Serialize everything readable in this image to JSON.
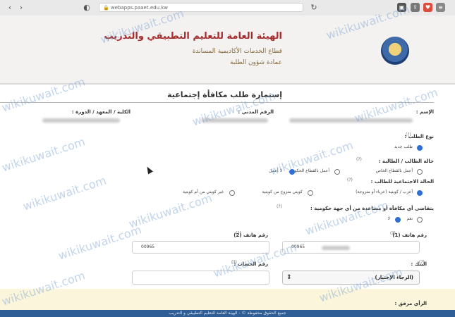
{
  "browser": {
    "url": "webapps.paaet.edu.kw"
  },
  "header": {
    "title": "الهيئة العامة للتعليم التطبيقي والتدريب",
    "subtitle1": "قطاع الخدمات الأكاديمية المساندة",
    "subtitle2": "عمادة شؤون الطلبة"
  },
  "form": {
    "title": "إستمارة طلب مكافأة إجتماعية",
    "name_label": "الإسم :",
    "civil_id_label": "الرقم المدني :",
    "college_label": "الكلية / المعهد / الدورة :",
    "request_type_label": "نوع الطلب :",
    "request_type_options": [
      "طلب جديد"
    ],
    "student_status_label": "حالة الطالب / الطالبة :",
    "student_status_options": [
      "لا أعمل",
      "أعمل بالقطاع الخاص",
      "أعمل بالقطاع الحكومي"
    ],
    "social_status_label": "الحالة الاجتماعية للطالب :",
    "social_status_options": [
      "أعزب / كويتية (عزباء أو متزوجة)",
      "كويتي متزوج من كويتية",
      "غير كويتي من أم كويتية"
    ],
    "gov_aid_label": "يتقاضى أي مكافأة أو مساعدة من أي جهة حكومية :",
    "gov_aid_options": [
      "لا",
      "نعم"
    ],
    "phone1_label": "رقم هاتف (1)",
    "phone1_value": "00965",
    "phone2_label": "رقم هاتف (2)",
    "phone2_value": "00965",
    "bank_label": "البنك :",
    "bank_value": "(الرجاء الإختيار)",
    "account_label": "رقم الحساب :",
    "extra_label": "الرأي مرفق :"
  },
  "footer": {
    "text": "جميع الحقوق محفوظة © - الهيئة العامة للتعليم التطبيقي و التدريب"
  },
  "watermark": {
    "text": "wikikuwait.com"
  },
  "icons": {
    "back": "chevron-left-icon",
    "forward": "chevron-right-icon",
    "lock": "lock-icon",
    "arrow": "select-arrow-icon"
  },
  "colors": {
    "title_red": "#a42c2c",
    "footer_blue": "#2f5d96",
    "radio_blue": "#2f6fd6"
  }
}
